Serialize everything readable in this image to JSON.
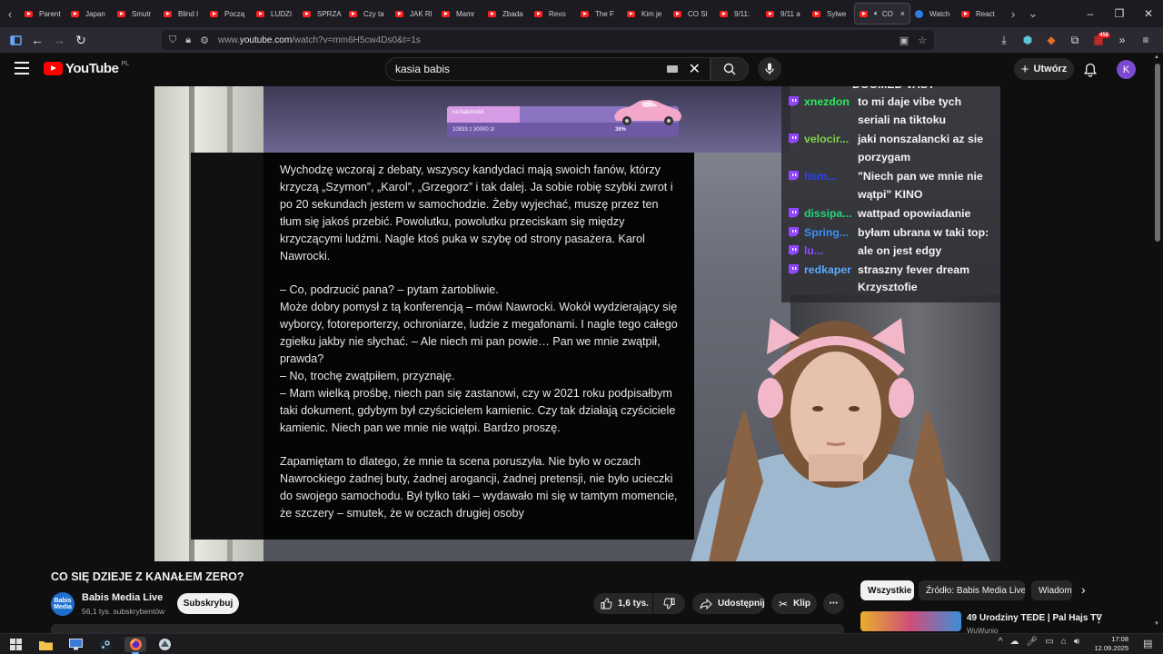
{
  "browser": {
    "tabs": [
      {
        "label": "Parent"
      },
      {
        "label": "Japan"
      },
      {
        "label": "Smutr"
      },
      {
        "label": "Blind I"
      },
      {
        "label": "Począ"
      },
      {
        "label": "LUDZI"
      },
      {
        "label": "SPRZA"
      },
      {
        "label": "Czy ta"
      },
      {
        "label": "JAK Rl"
      },
      {
        "label": "Mamr"
      },
      {
        "label": "Zbada"
      },
      {
        "label": "Revo"
      },
      {
        "label": "The F"
      },
      {
        "label": "Kim je"
      },
      {
        "label": "CO SI"
      },
      {
        "label": "9/11:"
      },
      {
        "label": "9/11 a"
      },
      {
        "label": "Sylwe"
      }
    ],
    "active_tab": {
      "label": "CO",
      "close": "×"
    },
    "tabs_after": [
      {
        "label": "Watch"
      },
      {
        "label": "React"
      }
    ],
    "url_prefix": "www.",
    "url_domain": "youtube.com",
    "url_path": "/watch?v=mm6H5cw4Ds0&t=1s",
    "extension_badge": "458"
  },
  "header": {
    "logo_text": "YouTube",
    "country_code": "PL",
    "search_value": "kasia babis",
    "create_label": "Utwórz",
    "avatar_letter": "K"
  },
  "video": {
    "donation": {
      "label": "na babimobil",
      "amount": "10933 z 30000 zł",
      "percent_text": "36%",
      "progress": 0.36
    },
    "article_paragraphs": [
      "Wychodzę wczoraj z debaty, wszyscy kandydaci mają swoich fanów, którzy krzyczą „Szymon”, „Karol”, „Grzegorz” i tak dalej. Ja sobie robię szybki zwrot i po 20 sekundach jestem w samochodzie. Żeby wyjechać, muszę przez ten tłum się jakoś przebić. Powolutku, powolutku przeciskam się między krzyczącymi ludźmi. Nagle ktoś puka w szybę od strony pasażera. Karol Nawrocki.",
      "– Co, podrzucić pana? – pytam żartobliwie.\nMoże dobry pomysł z tą konferencją – mówi Nawrocki. Wokół wydzierający się wyborcy, fotoreporterzy, ochroniarze, ludzie z megafonami. I nagle tego całego zgiełku jakby nie słychać. – Ale niech mi pan powie… Pan we mnie zwątpił, prawda?\n– No, trochę zwątpiłem, przyznaję.\n– Mam wielką prośbę, niech pan się zastanowi, czy w 2021 roku podpisałbym taki dokument, gdybym był czyścicielem kamienic. Czy tak działają czyściciele kamienic. Niech pan we mnie nie wątpi. Bardzo proszę.",
      "Zapamiętam to dlatego, że mnie ta scena poruszyła. Nie było w oczach Nawrockiego żadnej buty, żadnej arogancji, żadnej pretensji, nie było ucieczki do swojego samochodu. Był tylko taki – wydawało mi się w tamtym momencie, że szczery – smutek, że w oczach drugiej osoby"
    ],
    "chat": {
      "top_cut": "DOOMED VAST",
      "messages": [
        {
          "user": "xnezdon",
          "color": "#2ee85c",
          "lines": [
            "to mi daje vibe tych",
            "seriali na tiktoku"
          ]
        },
        {
          "user": "velocir...",
          "color": "#7fd447",
          "lines": [
            "jaki nonszalancki az sie",
            "porzygam"
          ]
        },
        {
          "user": "hsm...",
          "color": "#2a3fff",
          "lines": [
            "\"Niech pan we mnie nie",
            "wątpi\" KINO"
          ]
        },
        {
          "user": "dissipa...",
          "color": "#22d67a",
          "lines": [
            "wattpad opowiadanie"
          ]
        },
        {
          "user": "Spring...",
          "color": "#3d8ef5",
          "lines": [
            "byłam ubrana w taki top:"
          ]
        },
        {
          "user": "lu...",
          "color": "#8a4fff",
          "lines": [
            "ale on jest edgy"
          ]
        },
        {
          "user": "redkaper",
          "color": "#5aa9ff",
          "lines": [
            "straszny fever dream",
            "Krzysztofie"
          ]
        }
      ]
    }
  },
  "details": {
    "title": "CO SIĘ DZIEJE Z KANAŁEM ZERO?",
    "channel_name": "Babis Media Live",
    "channel_avatar_text": "Babis Media",
    "subscribers": "56,1 tys. subskrybentów",
    "subscribe_label": "Subskrybuj",
    "likes": "1,6 tys.",
    "share_label": "Udostępnij",
    "clip_label": "Klip"
  },
  "sidebar": {
    "chips": [
      {
        "label": "Wszystkie"
      },
      {
        "label": "Źródło: Babis Media Live"
      },
      {
        "label": "Wiadomości"
      }
    ],
    "rec_title": "49 Urodziny TEDE | Pal Hajs TV",
    "rec_channel": "WuWunio"
  },
  "taskbar": {
    "time": "17:08",
    "date": "12.09.2025"
  },
  "colors": {
    "youtube_red": "#ff0000",
    "background": "#0f0f0f",
    "chip_bg": "#272727"
  }
}
